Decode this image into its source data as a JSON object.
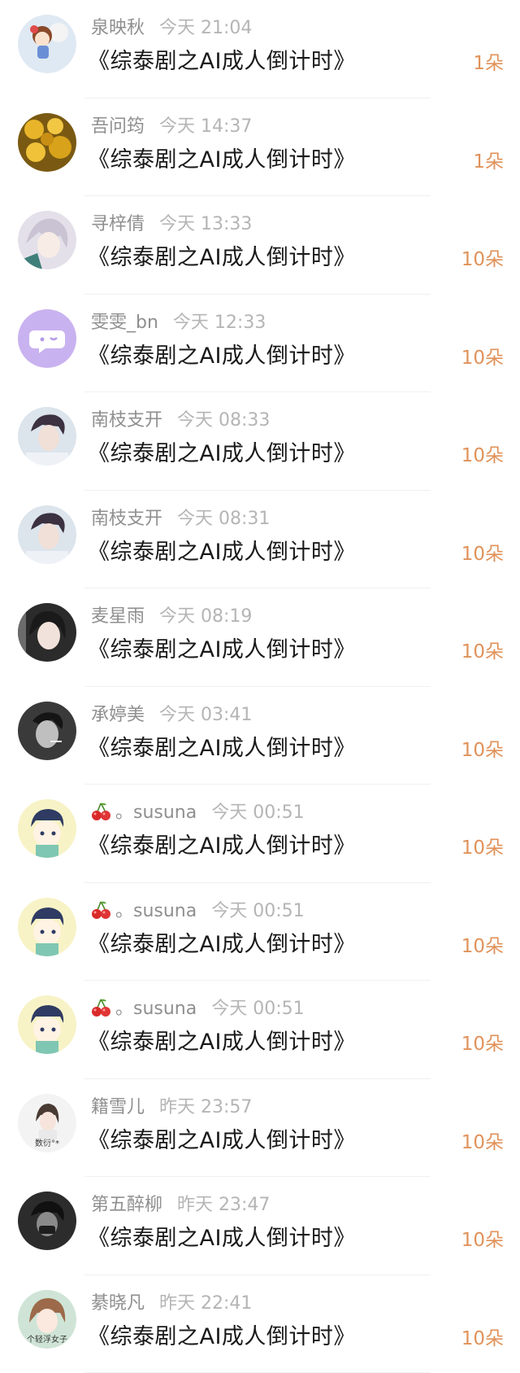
{
  "gift_list": [
    {
      "name": "泉映秋",
      "time": "今天 21:04",
      "title": "《综泰剧之AI成人倒计时》",
      "count": "1朵",
      "avatar": "avatar-anime-girl",
      "prefix": ""
    },
    {
      "name": "吾问筠",
      "time": "今天 14:37",
      "title": "《综泰剧之AI成人倒计时》",
      "count": "1朵",
      "avatar": "avatar-yellow-flowers",
      "prefix": ""
    },
    {
      "name": "寻梓倩",
      "time": "今天 13:33",
      "title": "《综泰剧之AI成人倒计时》",
      "count": "10朵",
      "avatar": "avatar-silver-hair",
      "prefix": ""
    },
    {
      "name": "雯雯_bn",
      "time": "今天 12:33",
      "title": "《综泰剧之AI成人倒计时》",
      "count": "10朵",
      "avatar": "avatar-purple-chat",
      "prefix": ""
    },
    {
      "name": "南枝支开",
      "time": "今天 08:33",
      "title": "《综泰剧之AI成人倒计时》",
      "count": "10朵",
      "avatar": "avatar-man-portrait",
      "prefix": ""
    },
    {
      "name": "南枝支开",
      "time": "今天 08:31",
      "title": "《综泰剧之AI成人倒计时》",
      "count": "10朵",
      "avatar": "avatar-man-portrait",
      "prefix": ""
    },
    {
      "name": "麦星雨",
      "time": "今天 08:19",
      "title": "《综泰剧之AI成人倒计时》",
      "count": "10朵",
      "avatar": "avatar-girl-dark",
      "prefix": ""
    },
    {
      "name": "承婷美",
      "time": "今天 03:41",
      "title": "《综泰剧之AI成人倒计时》",
      "count": "10朵",
      "avatar": "avatar-bw-man",
      "prefix": ""
    },
    {
      "name": "。susuna",
      "time": "今天 00:51",
      "title": "《综泰剧之AI成人倒计时》",
      "count": "10朵",
      "avatar": "avatar-cartoon-boy",
      "prefix": "cherry"
    },
    {
      "name": "。susuna",
      "time": "今天 00:51",
      "title": "《综泰剧之AI成人倒计时》",
      "count": "10朵",
      "avatar": "avatar-cartoon-boy",
      "prefix": "cherry"
    },
    {
      "name": "。susuna",
      "time": "今天 00:51",
      "title": "《综泰剧之AI成人倒计时》",
      "count": "10朵",
      "avatar": "avatar-cartoon-boy",
      "prefix": "cherry"
    },
    {
      "name": "籍雪儿",
      "time": "昨天 23:57",
      "title": "《综泰剧之AI成人倒计时》",
      "count": "10朵",
      "avatar": "avatar-girl-text",
      "prefix": ""
    },
    {
      "name": "第五醉柳",
      "time": "昨天 23:47",
      "title": "《综泰剧之AI成人倒计时》",
      "count": "10朵",
      "avatar": "avatar-dark-photo",
      "prefix": ""
    },
    {
      "name": "綦晓凡",
      "time": "昨天 22:41",
      "title": "《综泰剧之AI成人倒计时》",
      "count": "10朵",
      "avatar": "avatar-girl-text-2",
      "prefix": ""
    }
  ],
  "avatar_text": {
    "avatar-girl-text": "数衍°*",
    "avatar-girl-text-2": "个轻浮女子"
  },
  "colors": {
    "count": "#e0925a",
    "name": "#8f8f8f",
    "time": "#b5b5b5",
    "title": "#1a1a1a"
  }
}
